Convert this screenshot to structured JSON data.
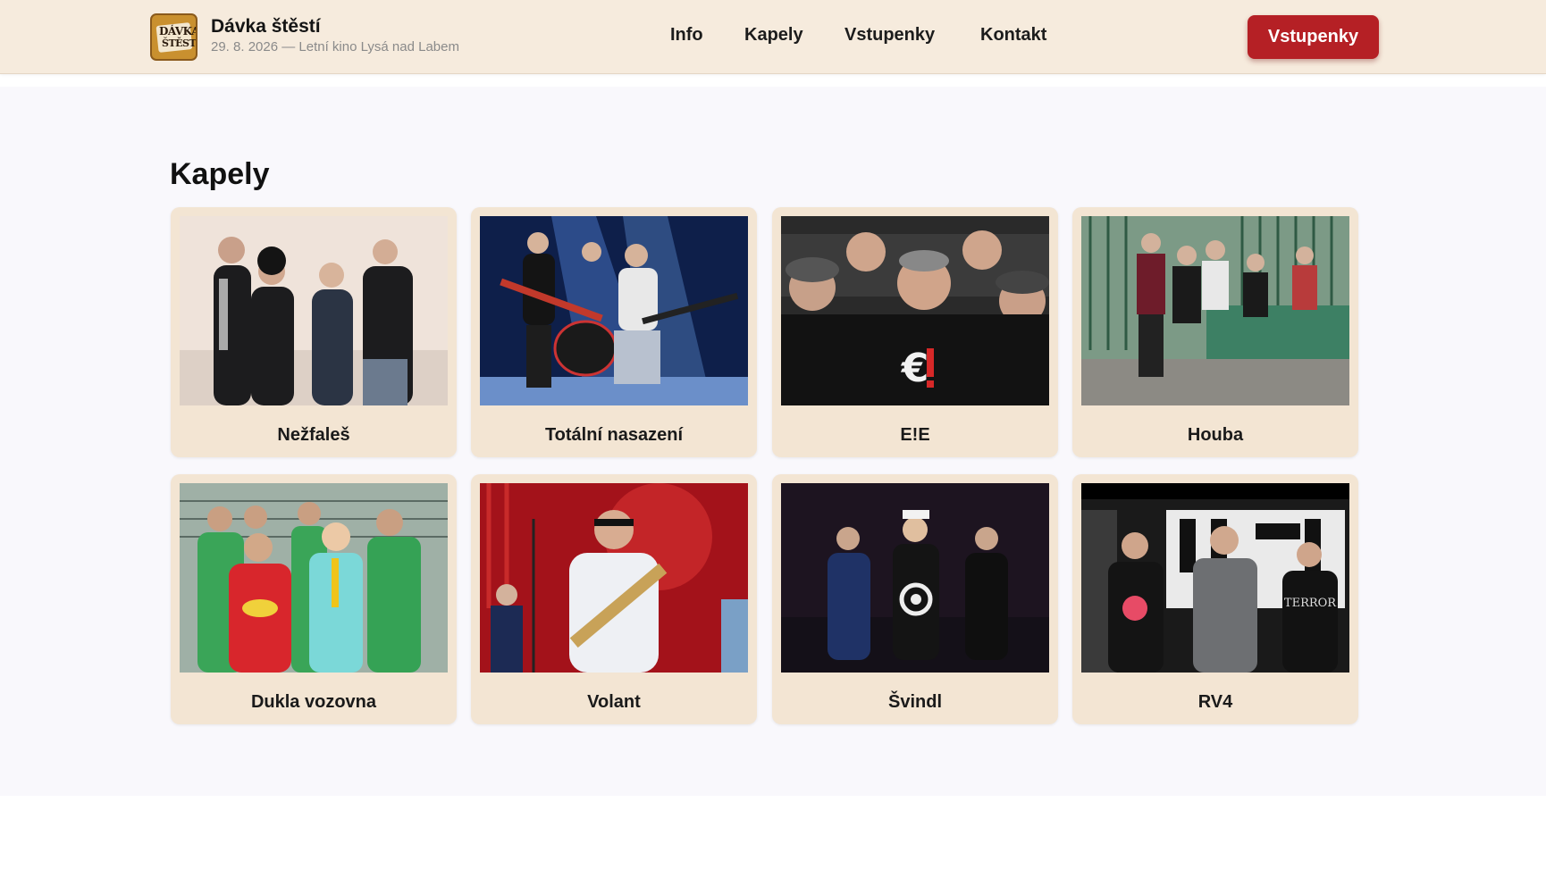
{
  "header": {
    "title": "Dávka štěstí",
    "subtitle": "29. 8. 2026 — Letní kino Lysá nad Labem",
    "logo_text_line1": "DÁVKA",
    "logo_text_line2": "ŠTĚSTÍ",
    "nav": [
      "Info",
      "Kapely",
      "Vstupenky",
      "Kontakt"
    ],
    "cta_label": "Vstupenky"
  },
  "section": {
    "title": "Kapely"
  },
  "bands": [
    {
      "name": "Nežfaleš",
      "photo": "band-photo-nezfales"
    },
    {
      "name": "Totální nasazení",
      "photo": "band-photo-totalni-nasazeni"
    },
    {
      "name": "E!E",
      "photo": "band-photo-ee"
    },
    {
      "name": "Houba",
      "photo": "band-photo-houba"
    },
    {
      "name": "Dukla vozovna",
      "photo": "band-photo-dukla-vozovna"
    },
    {
      "name": "Volant",
      "photo": "band-photo-volant"
    },
    {
      "name": "Švindl",
      "photo": "band-photo-svindl"
    },
    {
      "name": "RV4",
      "photo": "band-photo-rv4"
    }
  ],
  "colors": {
    "header_bg": "#f6ebdd",
    "accent": "#b52025",
    "card_bg": "#f3e5d3",
    "page_bg": "#f9f8fc"
  }
}
